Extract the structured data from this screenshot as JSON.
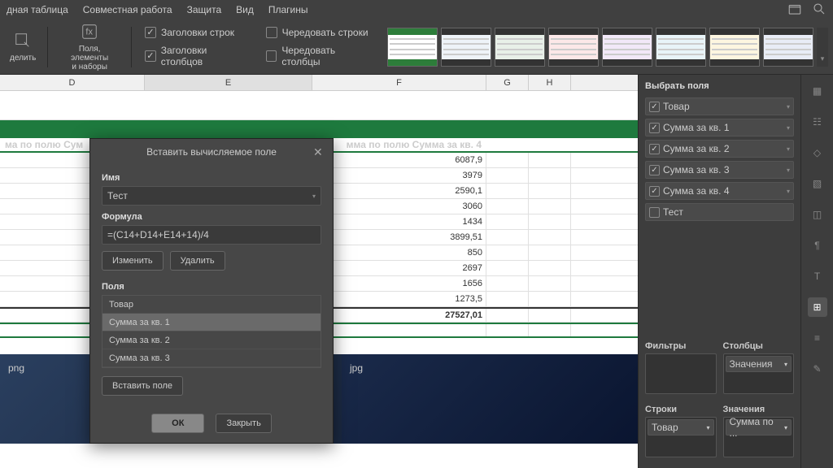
{
  "menu": {
    "items": [
      "дная таблица",
      "Совместная работа",
      "Защита",
      "Вид",
      "Плагины"
    ]
  },
  "ribbon": {
    "select": "делить",
    "fields": "Поля, элементы\nи наборы",
    "checks": {
      "rowHdr": "Заголовки строк",
      "colHdr": "Заголовки столбцов",
      "altRows": "Чередовать строки",
      "altCols": "Чередовать столбцы"
    }
  },
  "cols": [
    "D",
    "E",
    "F",
    "G",
    "H"
  ],
  "header": {
    "left": "ма по полю  Сум",
    "right": "мма по полю  Сумма за кв. 4"
  },
  "values": [
    "6087,9",
    "3979",
    "2590,1",
    "3060",
    "1434",
    "3899,51",
    "850",
    "2697",
    "1656",
    "1273,5"
  ],
  "total": "27527,01",
  "imgs": {
    "png": "png",
    "jpg": "jpg"
  },
  "side": {
    "title": "Выбрать поля",
    "fields": [
      {
        "label": "Товар",
        "on": true
      },
      {
        "label": "Сумма за кв. 1",
        "on": true
      },
      {
        "label": "Сумма за кв. 2",
        "on": true
      },
      {
        "label": "Сумма за кв. 3",
        "on": true
      },
      {
        "label": "Сумма за кв. 4",
        "on": true
      },
      {
        "label": "Тест",
        "on": false
      }
    ],
    "filters": "Фильтры",
    "columns": "Столбцы",
    "rows": "Строки",
    "values": "Значения",
    "colPill": "Значения",
    "rowPill": "Товар",
    "valPill": "Сумма по ..."
  },
  "dialog": {
    "title": "Вставить вычисляемое поле",
    "nameLabel": "Имя",
    "nameVal": "Тест",
    "formulaLabel": "Формула",
    "formulaVal": "=(C14+D14+E14+14)/4",
    "edit": "Изменить",
    "delete": "Удалить",
    "fieldsLabel": "Поля",
    "fields": [
      "Товар",
      "Сумма за кв. 1",
      "Сумма за кв. 2",
      "Сумма за кв. 3"
    ],
    "insertField": "Вставить поле",
    "ok": "ОК",
    "close": "Закрыть"
  }
}
